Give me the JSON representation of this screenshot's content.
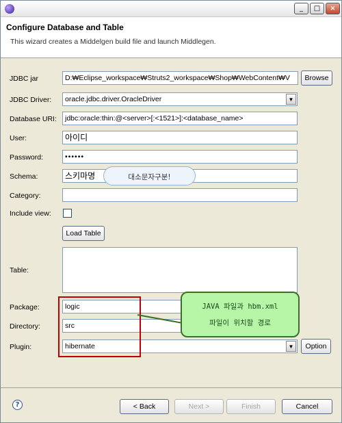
{
  "window": {
    "app_icon": "eclipse-icon",
    "controls": {
      "minimize": "_",
      "maximize": "□",
      "close": "×"
    }
  },
  "header": {
    "title": "Configure Database and Table",
    "subtitle": "This wizard creates a Middelgen build file and launch Middlegen."
  },
  "fields": {
    "jdbc_jar": {
      "label": "JDBC jar",
      "value": "D:₩Eclipse_workspace₩Struts2_workspace₩Shop₩WebContent₩V"
    },
    "jdbc_driver": {
      "label": "JDBC Driver:",
      "value": "oracle.jdbc.driver.OracleDriver"
    },
    "database_uri": {
      "label": "Database URI:",
      "value": "jdbc:oracle:thin:@<server>[:<1521>]:<database_name>"
    },
    "user": {
      "label": "User:",
      "value": "아이디"
    },
    "password": {
      "label": "Password:",
      "value": "••••••"
    },
    "schema": {
      "label": "Schema:",
      "value": "스키마명"
    },
    "category": {
      "label": "Category:",
      "value": ""
    },
    "include_view": {
      "label": "Include view:",
      "checked": false
    },
    "table": {
      "label": "Table:"
    },
    "package": {
      "label": "Package:",
      "value": "logic"
    },
    "directory": {
      "label": "Directory:",
      "value": "src"
    },
    "plugin": {
      "label": "Plugin:",
      "value": "hibernate"
    }
  },
  "buttons": {
    "browse": "Browse",
    "load_table": "Load Table",
    "option": "Option",
    "back": "< Back",
    "next": "Next >",
    "finish": "Finish",
    "cancel": "Cancel"
  },
  "annotations": {
    "cloud": "대소문자구분!",
    "callout_line1": "JAVA 파일과 hbm.xml",
    "callout_line2": "파일이 위치할 경로"
  },
  "colors": {
    "highlight_box": "#c00000",
    "callout_fill": "#b7f6a6"
  }
}
